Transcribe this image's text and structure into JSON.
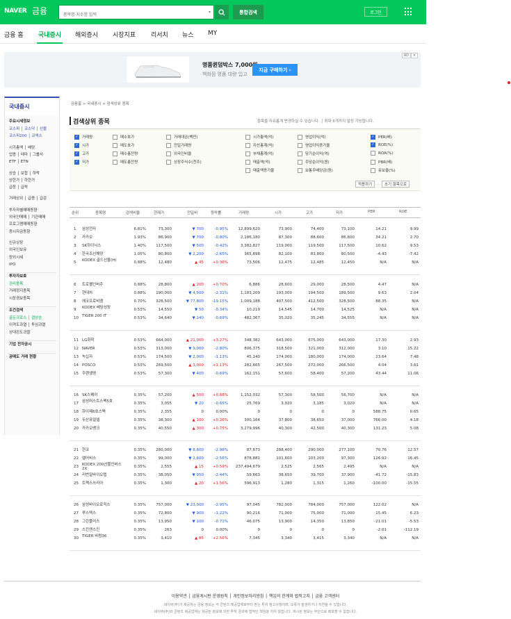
{
  "header": {
    "logo": "NAVER",
    "logo_sub": "금융",
    "search_placeholder": "종목명·지수명 입력",
    "total_search": "통합검색",
    "login": "로그인"
  },
  "nav": {
    "tabs": [
      "금융 홈",
      "국내증시",
      "해외증시",
      "시장지표",
      "리서치",
      "뉴스",
      "MY"
    ]
  },
  "ad": {
    "label": "AD",
    "close": "✕",
    "title": "명품퀸덤박스 7,000원",
    "subtitle": "백화점 명품 대량 입고",
    "button": "지금 구매하기 ›"
  },
  "sidebar": {
    "title": "국내증시",
    "sections": [
      {
        "head": "주요시세정보",
        "items": [
          "코스피 │ 코스닥 │ 선물",
          "코스피200 │ 코넥스",
          "",
          "시가총액 │ 배당",
          "업종 │ 테마 │ 그룹사",
          "ETF │ ETN",
          "",
          "상승 │ 보합 │ 하락",
          "상한가 │ 하한가",
          "급등 │ 급락",
          "",
          "거래상위 │ 급증 │ 급감",
          "",
          "투자자별매매동향",
          "외국인매매 │ 기관매매",
          "프로그램매매동향",
          "증시자금동향",
          "",
          "신규상장",
          "외국인보유",
          "장외시세",
          "IPO"
        ]
      },
      {
        "head": "투자자보호",
        "items": [
          "관리종목",
          "거래정지종목",
          "시장경보종목"
        ]
      },
      {
        "head": "조건검색",
        "items": [
          "골든크로스 │ 갭상승",
          "이격도과열 │ 투심과열",
          "상대강도과열"
        ]
      },
      {
        "head": "기업 전자공시",
        "items": []
      },
      {
        "head": "공매도 거래 현황",
        "items": []
      }
    ]
  },
  "main": {
    "breadcrumb": "금융홈 > 국내증시 > 검색상위 종목",
    "title": "검색상위 종목",
    "note": "항목을 자유롭게 변경하실 수 있습니다.  │  최대 6개까지 설정 가능합니다.",
    "checkboxes": [
      [
        {
          "label": "거래량",
          "checked": true
        },
        {
          "label": "시가",
          "checked": true
        },
        {
          "label": "고가",
          "checked": true
        },
        {
          "label": "저가",
          "checked": true
        }
      ],
      [
        {
          "label": "매수호가",
          "checked": false
        },
        {
          "label": "매도호가",
          "checked": false
        },
        {
          "label": "매수총잔량",
          "checked": false
        },
        {
          "label": "매도총잔량",
          "checked": false
        }
      ],
      [
        {
          "label": "거래대금(백만)",
          "checked": false
        },
        {
          "label": "전일거래량",
          "checked": false
        },
        {
          "label": "외국인비율",
          "checked": false
        },
        {
          "label": "상장주식수(천주)",
          "checked": false
        }
      ],
      [
        {
          "label": "시가총액(억)",
          "checked": false
        },
        {
          "label": "자산총계(억)",
          "checked": false
        },
        {
          "label": "부채총계(억)",
          "checked": false
        },
        {
          "label": "매출액(억)",
          "checked": false
        },
        {
          "label": "매출액증가율",
          "checked": false
        }
      ],
      [
        {
          "label": "영업이익(억)",
          "checked": false
        },
        {
          "label": "영업이익증가율",
          "checked": false
        },
        {
          "label": "당기순이익(억)",
          "checked": false
        },
        {
          "label": "주당순이익(원)",
          "checked": false
        },
        {
          "label": "보통주배당금(원)",
          "checked": false
        }
      ],
      [
        {
          "label": "PER(배)",
          "checked": true
        },
        {
          "label": "ROE(%)",
          "checked": true
        },
        {
          "label": "ROA(%)",
          "checked": false
        },
        {
          "label": "PBR(배)",
          "checked": false
        },
        {
          "label": "유보율(%)",
          "checked": false
        }
      ]
    ],
    "apply_button": "적용하기",
    "reset_button": "초기 항목으로",
    "columns": [
      "순위",
      "종목명",
      "검색비율",
      "현재가",
      "전일비",
      "등락률",
      "거래량",
      "시가",
      "고가",
      "저가",
      "PER",
      "ROE"
    ],
    "rows": [
      [
        "1",
        "삼성전자",
        "6.81%",
        "73,300",
        "700",
        "-0.95%",
        "12,899,620",
        "73,900",
        "74,400",
        "73,100",
        "14.21",
        "9.99",
        "dn"
      ],
      [
        "2",
        "카카오",
        "1.93%",
        "86,900",
        "700",
        "-0.80%",
        "2,186,180",
        "87,300",
        "88,600",
        "86,600",
        "34.21",
        "2.70",
        "dn"
      ],
      [
        "3",
        "SK하이닉스",
        "1.40%",
        "117,500",
        "500",
        "-0.42%",
        "3,382,827",
        "119,000",
        "119,500",
        "117,500",
        "10.62",
        "9.53",
        "dn"
      ],
      [
        "4",
        "한국조선해양",
        "1.05%",
        "80,800",
        "2,200",
        "-2.65%",
        "365,898",
        "82,100",
        "83,800",
        "80,500",
        "-4.43",
        "-7.42",
        "dn"
      ],
      [
        "5",
        "KODEX 골드선물(H)",
        "0.88%",
        "12,480",
        "45",
        "+0.36%",
        "73,506",
        "12,475",
        "12,485",
        "12,450",
        "N/A",
        "N/A",
        "up"
      ],
      [
        "6",
        "트로웰인버주",
        "0.88%",
        "28,800",
        "200",
        "+0.70%",
        "6,886",
        "28,600",
        "29,000",
        "28,500",
        "4.47",
        "N/A",
        "up"
      ],
      [
        "7",
        "현대차",
        "0.88%",
        "190,000",
        "4,500",
        "-2.31%",
        "1,183,209",
        "193,000",
        "194,500",
        "189,500",
        "9.63",
        "2.04",
        "dn"
      ],
      [
        "8",
        "에코프로비엠",
        "0.70%",
        "328,500",
        "77,800",
        "-19.15%",
        "1,009,188",
        "407,500",
        "412,500",
        "328,500",
        "88.35",
        "N/A",
        "dn"
      ],
      [
        "9",
        "KODEX 배당성장",
        "0.53%",
        "14,550",
        "50",
        "-0.34%",
        "10,219",
        "14,545",
        "14,700",
        "14,525",
        "N/A",
        "N/A",
        "dn"
      ],
      [
        "10",
        "TIGER 200 IT",
        "0.53%",
        "34,640",
        "240",
        "-0.69%",
        "482,367",
        "35,020",
        "35,245",
        "34,555",
        "N/A",
        "N/A",
        "dn"
      ],
      [
        "11",
        "LG화학",
        "0.53%",
        "664,000",
        "21,000",
        "+3.27%",
        "348,382",
        "643,000",
        "675,000",
        "643,000",
        "17.30",
        "2.93",
        "up"
      ],
      [
        "12",
        "NAVER",
        "0.53%",
        "313,000",
        "9,000",
        "-2.80%",
        "806,375",
        "318,500",
        "321,000",
        "312,000",
        "3.10",
        "15.22",
        "dn"
      ],
      [
        "13",
        "녹십자",
        "0.53%",
        "174,500",
        "2,000",
        "-1.13%",
        "45,140",
        "174,000",
        "180,000",
        "174,000",
        "23.64",
        "7.48",
        "dn"
      ],
      [
        "14",
        "POSCO",
        "0.53%",
        "269,500",
        "3,000",
        "+1.13%",
        "282,665",
        "267,500",
        "272,000",
        "266,500",
        "4.04",
        "3.61",
        "up"
      ],
      [
        "15",
        "주랜생명",
        "0.53%",
        "57,300",
        "400",
        "-0.69%",
        "162,151",
        "57,600",
        "58,400",
        "57,200",
        "43.44",
        "11.06",
        "dn"
      ],
      [
        "16",
        "SK스퀘어",
        "0.35%",
        "57,200",
        "500",
        "+0.88%",
        "1,152,032",
        "57,300",
        "58,500",
        "56,700",
        "N/A",
        "N/A",
        "up"
      ],
      [
        "17",
        "삼성머스트스팩5호",
        "0.35%",
        "3,055",
        "20",
        "-0.65%",
        "25,769",
        "3,020",
        "3,185",
        "3,020",
        "N/A",
        "N/A",
        "dn"
      ],
      [
        "18",
        "하이제6호스팩",
        "0.35%",
        "2,355",
        "0",
        "0.00%",
        "0",
        "0",
        "0",
        "0",
        "588.75",
        "0.65",
        ""
      ],
      [
        "19",
        "두산퓨얼셀",
        "0.35%",
        "38,300",
        "100",
        "+0.26%",
        "300,164",
        "37,800",
        "38,650",
        "37,000",
        "766.00",
        "4.18",
        "up"
      ],
      [
        "20",
        "카카오뱅크",
        "0.35%",
        "40,550",
        "300",
        "+0.75%",
        "3,279,996",
        "40,300",
        "42,500",
        "40,300",
        "131.23",
        "5.08",
        "up"
      ],
      [
        "21",
        "현코",
        "0.35%",
        "280,000",
        "8,600",
        "-2.98%",
        "87,673",
        "288,400",
        "290,000",
        "277,100",
        "70.76",
        "12.57",
        "dn"
      ],
      [
        "22",
        "엘어비스",
        "0.35%",
        "99,000",
        "2,600",
        "-2.56%",
        "878,881",
        "101,600",
        "103,200",
        "97,300",
        "126.92",
        "16.45",
        "dn"
      ],
      [
        "23",
        "KODEX 200선물인버스2X",
        "0.35%",
        "2,555",
        "15",
        "+0.59%",
        "237,494,679",
        "2,525",
        "2,565",
        "2,495",
        "N/A",
        "N/A",
        "up"
      ],
      [
        "24",
        "리번알바이오텝",
        "0.35%",
        "38,050",
        "950",
        "-2.44%",
        "59,663",
        "38,650",
        "39,700",
        "37,900",
        "-41.72",
        "-15.83",
        "dn"
      ],
      [
        "25",
        "트랙스쓰리아",
        "0.35%",
        "1,300",
        "20",
        "+1.56%",
        "596,913",
        "1,280",
        "1,315",
        "1,260",
        "-100.00",
        "-15.55",
        "up"
      ],
      [
        "26",
        "삼성바이오로직스",
        "0.35%",
        "757,000",
        "23,000",
        "-2.95%",
        "97,045",
        "782,000",
        "784,000",
        "757,000",
        "122.02",
        "N/A",
        "dn"
      ],
      [
        "27",
        "루스텍스",
        "0.35%",
        "72,800",
        "900",
        "-1.22%",
        "90,216",
        "71,000",
        "75,000",
        "71,000",
        "15.45",
        "6.23",
        "dn"
      ],
      [
        "28",
        "그린플러스",
        "0.35%",
        "13,950",
        "100",
        "-0.71%",
        "46,075",
        "13,900",
        "14,350",
        "13,850",
        "-21.01",
        "-5.53",
        "dn"
      ],
      [
        "29",
        "스킨앤스킨",
        "0.35%",
        "263",
        "0",
        "0.00%",
        "0",
        "0",
        "0",
        "0",
        "-2.01",
        "-112.19",
        ""
      ],
      [
        "30",
        "TIGER 바텀36",
        "0.35%",
        "3,410",
        "85",
        "+2.56%",
        "7,345",
        "3,340",
        "3,415",
        "3,340",
        "N/A",
        "N/A",
        "up"
      ]
    ]
  },
  "footer": {
    "links": "이용약관  │  금융게시판 운영원칙  │  개인정보처리방침  │  책임의 한계와 법적고지  │  금융 고객센터",
    "line1": "네이버(주)가 제공하는 금융 정보는 각 콘텐츠 제공업체로부터 받는 투자 참고사항이며, 오류가 발생하거나 지연될 수 있습니다.",
    "line2": "네이버(주)와 콘텐츠 제공업체는 제공된 정보에 의한 투자 결과에 법적인 책임을 지지 않습니다. 게시된 정보는 무단으로 배포할 수 없습니다."
  }
}
